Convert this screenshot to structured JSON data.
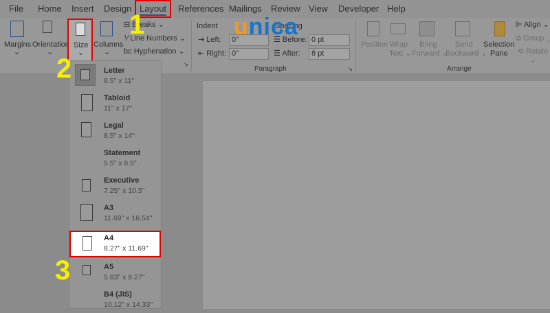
{
  "tabs": [
    "File",
    "Home",
    "Insert",
    "Design",
    "Layout",
    "References",
    "Mailings",
    "Review",
    "View",
    "Developer",
    "Help"
  ],
  "active_tab": "Layout",
  "page_setup": {
    "margins": "Margins",
    "orientation": "Orientation",
    "size": "Size",
    "columns": "Columns",
    "breaks": "Breaks",
    "line_numbers": "Line Numbers",
    "hyphenation": "Hyphenation"
  },
  "paragraph": {
    "indent": "Indent",
    "spacing": "Spacing",
    "left_label": "Left:",
    "left_value": "0\"",
    "right_label": "Right:",
    "right_value": "0\"",
    "before_label": "Before:",
    "before_value": "0 pt",
    "after_label": "After:",
    "after_value": "8 pt",
    "group_label": "Paragraph"
  },
  "arrange": {
    "position": "Position",
    "wrap_text_1": "Wrap",
    "wrap_text_2": "Text",
    "bring_1": "Bring",
    "bring_2": "Forward",
    "send_1": "Send",
    "send_2": "Backward",
    "selection_1": "Selection",
    "selection_2": "Pane",
    "align": "Align",
    "group": "Group",
    "rotate": "Rotate",
    "group_label": "Arrange"
  },
  "logo": {
    "text": "unica",
    "color_u": "#f39a1e",
    "color_rest": "#1a73c9"
  },
  "steps": [
    "1",
    "2",
    "3"
  ],
  "size_menu": [
    {
      "name": "Letter",
      "size": "8.5\" x 11\""
    },
    {
      "name": "Tabloid",
      "size": "11\" x 17\""
    },
    {
      "name": "Legal",
      "size": "8.5\" x 14\""
    },
    {
      "name": "Statement",
      "size": "5.5\" x 8.5\""
    },
    {
      "name": "Executive",
      "size": "7.25\" x 10.5\""
    },
    {
      "name": "A3",
      "size": "11.69\" x 16.54\""
    },
    {
      "name": "A4",
      "size": "8.27\" x 11.69\""
    },
    {
      "name": "A5",
      "size": "5.83\" x 8.27\""
    },
    {
      "name": "B4 (JIS)",
      "size": "10.12\" x 14.33\""
    }
  ],
  "highlight_color": "#e00000",
  "step_color": "#f5f000"
}
